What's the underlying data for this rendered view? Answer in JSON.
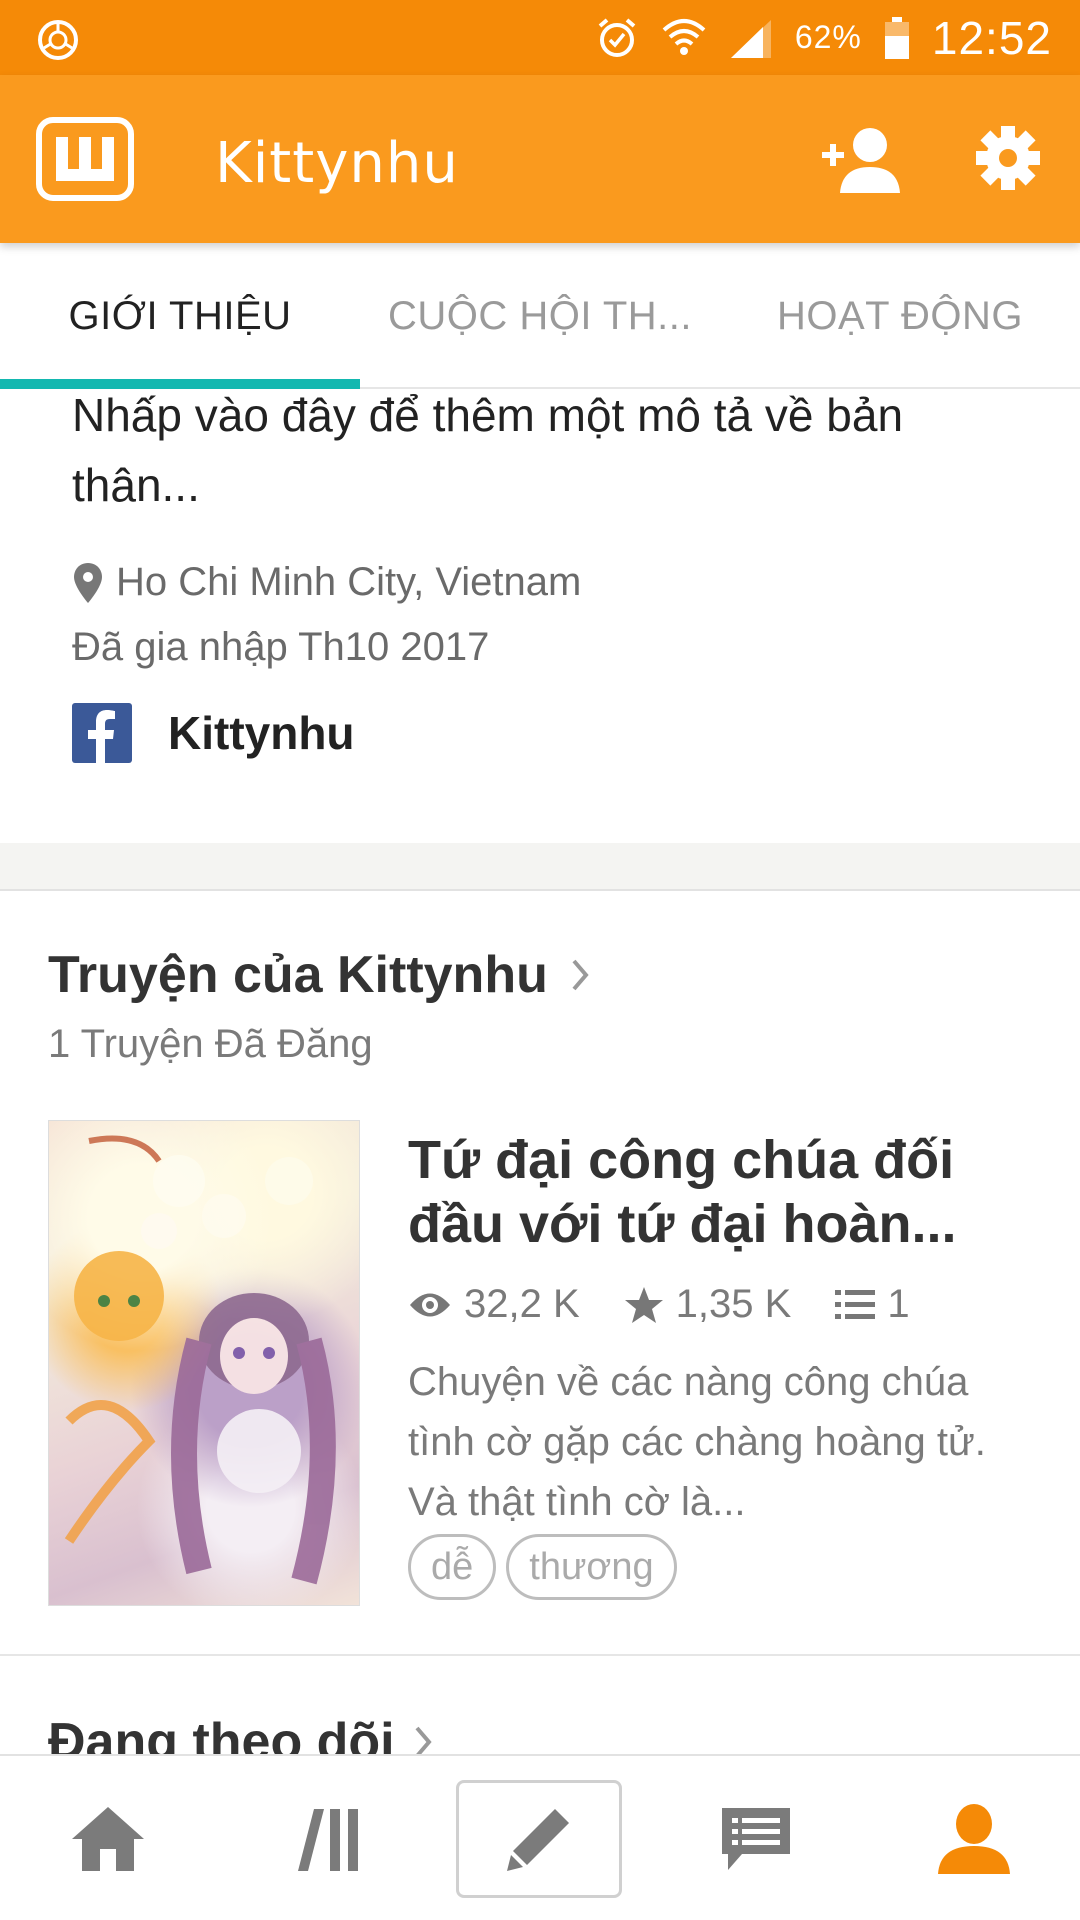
{
  "status_bar": {
    "battery": "62%",
    "time": "12:52"
  },
  "app_bar": {
    "title": "Kittynhu"
  },
  "tabs": [
    {
      "label": "GIỚI THIỆU"
    },
    {
      "label": "CUỘC HỘI TH..."
    },
    {
      "label": "HOẠT ĐỘNG"
    }
  ],
  "about": {
    "description": "Nhấp vào đây để thêm một mô tả về bản thân...",
    "location": "Ho Chi Minh City, Vietnam",
    "joined": "Đã gia nhập Th10 2017",
    "facebook_name": "Kittynhu"
  },
  "stories": {
    "title": "Truyện của Kittynhu",
    "count": "1 Truyện Đã Đăng",
    "items": [
      {
        "title": "Tứ đại công chúa đối đầu với tứ đại hoàn...",
        "reads": "32,2 K",
        "votes": "1,35 K",
        "parts": "1",
        "description": "Chuyện về các nàng công chúa tình cờ gặp các chàng hoàng tử. Và thật tình cờ là...",
        "tags": [
          "dễ",
          "thương"
        ]
      }
    ]
  },
  "following": {
    "title": "Đang theo dõi"
  },
  "colors": {
    "status_bar": "#f58a07",
    "app_bar": "#fa9a1e",
    "tab_indicator": "#13b8b0",
    "active_nav": "#f58a07",
    "inactive_nav": "#7b7b7b"
  },
  "icons": {
    "status_left": "clock-app-icon",
    "alarm": "alarm-icon",
    "wifi": "wifi-icon",
    "signal": "signal-icon",
    "battery": "battery-icon",
    "logo": "wattpad-logo-icon",
    "add_friend": "add-friend-icon",
    "settings": "gear-icon",
    "location": "location-pin-icon",
    "facebook": "facebook-icon",
    "reads": "eye-icon",
    "votes": "star-icon",
    "parts": "list-icon",
    "nav": [
      "home-icon",
      "library-icon",
      "pencil-icon",
      "message-icon",
      "profile-icon"
    ]
  }
}
